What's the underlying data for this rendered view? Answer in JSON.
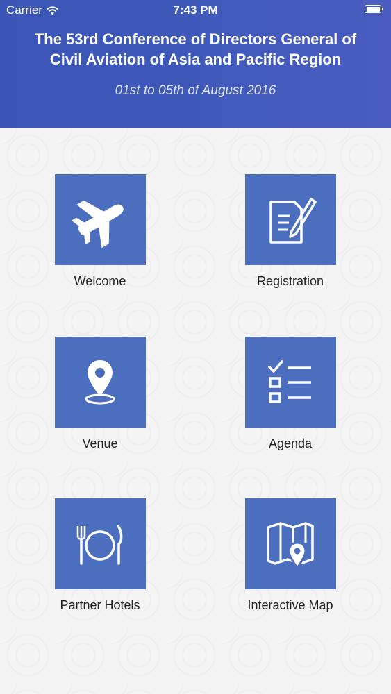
{
  "status_bar": {
    "carrier": "Carrier",
    "time": "7:43 PM"
  },
  "header": {
    "title": "The 53rd Conference of Directors General of\nCivil Aviation of Asia and Pacific Region",
    "subtitle": "01st to 05th of August 2016"
  },
  "colors": {
    "header": "#3f59bb",
    "tile": "#4b6fbe",
    "label": "#222222"
  },
  "menu": [
    {
      "label": "Welcome",
      "icon": "airplane-icon"
    },
    {
      "label": "Registration",
      "icon": "edit-document-icon"
    },
    {
      "label": "Venue",
      "icon": "location-pin-icon"
    },
    {
      "label": "Agenda",
      "icon": "checklist-icon"
    },
    {
      "label": "Partner Hotels",
      "icon": "fork-plate-knife-icon"
    },
    {
      "label": "Interactive Map",
      "icon": "map-pin-icon"
    }
  ]
}
